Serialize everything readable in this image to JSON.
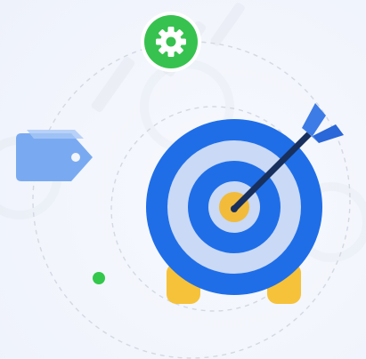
{
  "illustration": {
    "subject": "target-with-arrow",
    "icons": [
      "gear-icon",
      "price-tag-icon",
      "target-icon",
      "arrow-icon"
    ],
    "colors": {
      "background": "#f3f6fc",
      "target_blue": "#1f6ee8",
      "target_light": "#c9d9f6",
      "target_center": "#f2bb3a",
      "target_stand": "#f6c23a",
      "arrow_shaft": "#18305e",
      "arrow_fletching": "#3d7be6",
      "gear_badge": "#37c24f",
      "tag_blue": "#79aaf1",
      "dot_green": "#33c84c",
      "orbit_dash": "#d3d8e2"
    }
  }
}
